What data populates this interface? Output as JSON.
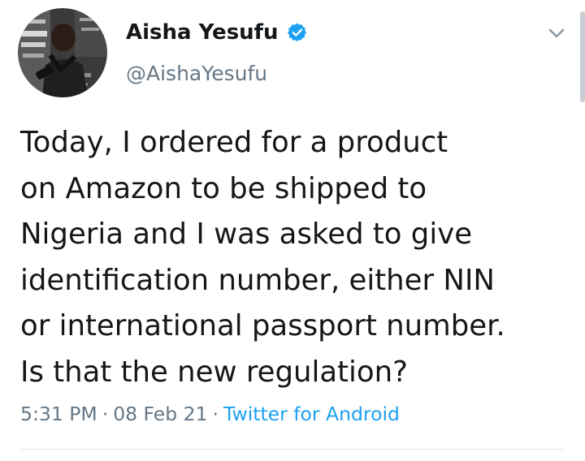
{
  "author": {
    "display_name": "Aisha Yesufu",
    "handle": "@AishaYesufu",
    "verified": true,
    "avatar_icon": "profile-photo"
  },
  "tweet": {
    "lines": [
      "Today, I ordered for a product",
      "on Amazon to be shipped to",
      "Nigeria and I was asked to give",
      "identification number, either NIN",
      "or international passport number.",
      "Is that the new regulation?"
    ],
    "time": "5:31 PM",
    "date": "08 Feb 21",
    "separator": "·",
    "source": "Twitter for Android"
  },
  "icons": {
    "verified": "verified-badge-icon",
    "menu": "chevron-down-icon"
  },
  "colors": {
    "text": "#14171a",
    "secondary": "#657786",
    "accent": "#1da1f2",
    "divider": "#e1e8ed"
  }
}
